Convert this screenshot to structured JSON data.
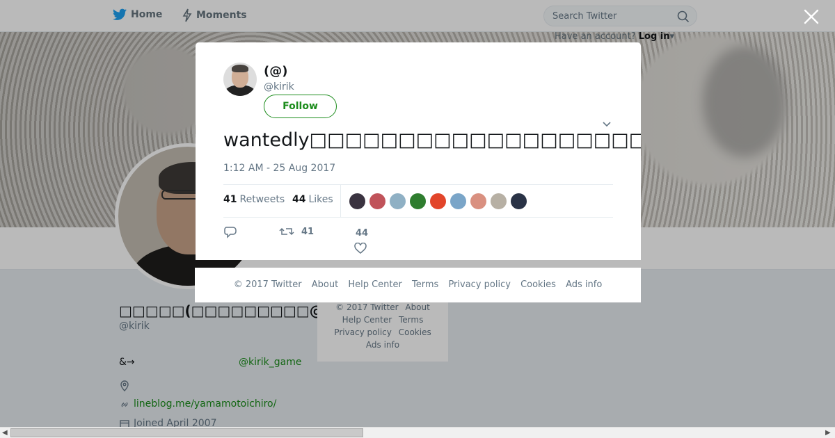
{
  "topbar": {
    "home_label": "Home",
    "moments_label": "Moments",
    "search_placeholder": "Search Twitter",
    "have_account_text": "Have an account?",
    "login_label": "Log in"
  },
  "profile": {
    "name": "□□□□□(□□□□□□□□□@□□□□)",
    "handle": "@kirik",
    "bio_prefix": "&→",
    "bio_link": "@kirik_game",
    "url": "lineblog.me/yamamotoichiro/",
    "joined": "Joined April 2007"
  },
  "side_footer": {
    "items": [
      "© 2017 Twitter",
      "About",
      "Help Center",
      "Terms",
      "Privacy policy",
      "Cookies",
      "Ads info"
    ]
  },
  "modal": {
    "name": "(@)",
    "handle": "@kirik",
    "follow_label": "Follow",
    "tweet_text": "wantedly□□□□□□□□□□□□□□□□□□□□□□□□□□□□□□□□□□□□□□□□□□□□□□□□□□□□□□□□□□□□□□",
    "timestamp": "1:12 AM - 25 Aug 2017",
    "retweets_count": "41",
    "retweets_label": "Retweets",
    "likes_count": "44",
    "likes_label": "Likes",
    "liker_colors": [
      "#3a3340",
      "#c0535a",
      "#8fb0c4",
      "#2f7d2f",
      "#e2452a",
      "#7aa5c8",
      "#d99080",
      "#b7b0a4",
      "#2a3346"
    ],
    "action_retweet_count": "41",
    "action_like_count": "44"
  },
  "modal_footer": {
    "items": [
      "© 2017 Twitter",
      "About",
      "Help Center",
      "Terms",
      "Privacy policy",
      "Cookies",
      "Ads info"
    ]
  },
  "colors": {
    "accent_green": "#1b8c1b",
    "muted_text": "#657786",
    "twitter_blue": "#1da1f2"
  }
}
